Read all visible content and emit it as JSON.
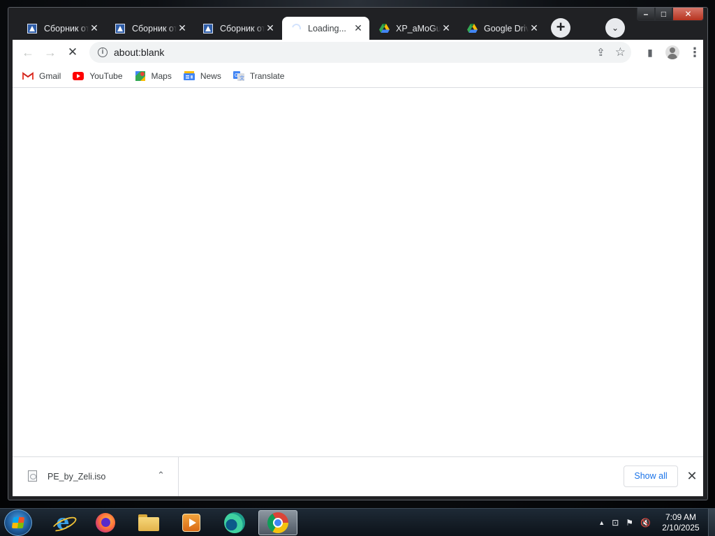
{
  "browser": {
    "tabs": [
      {
        "title": "Сборник от",
        "icon": "doc-icon",
        "active": false
      },
      {
        "title": "Сборник от",
        "icon": "doc-icon",
        "active": false
      },
      {
        "title": "Сборник от",
        "icon": "doc-icon",
        "active": false
      },
      {
        "title": "Loading...",
        "icon": "loading-spinner-icon",
        "active": true
      },
      {
        "title": "XP_aMoGus",
        "icon": "google-drive-icon",
        "active": false
      },
      {
        "title": "Google Drive",
        "icon": "google-drive-icon",
        "active": false
      }
    ],
    "new_tab_label": "+",
    "tab_search_label": "⌄",
    "window_controls": {
      "minimize": "–",
      "maximize": "□",
      "close": "✕"
    }
  },
  "toolbar": {
    "back_label": "←",
    "forward_label": "→",
    "stop_label": "✕",
    "url": "about:blank",
    "info_label": "i",
    "share_label": "⇪",
    "bookmark_label": "☆",
    "sidepanel_label": "▮",
    "menu_label": "⋮"
  },
  "bookmarks": [
    {
      "label": "Gmail",
      "icon": "gmail-icon"
    },
    {
      "label": "YouTube",
      "icon": "youtube-icon"
    },
    {
      "label": "Maps",
      "icon": "maps-icon"
    },
    {
      "label": "News",
      "icon": "news-icon"
    },
    {
      "label": "Translate",
      "icon": "translate-icon"
    }
  ],
  "downloads": {
    "file_name": "PE_by_Zeli.iso",
    "caret": "⌃",
    "show_all": "Show all",
    "close": "✕"
  },
  "taskbar": {
    "apps": [
      "internet-explorer-icon",
      "firefox-icon",
      "file-explorer-icon",
      "media-player-icon",
      "edge-icon",
      "chrome-icon"
    ],
    "tray": {
      "arrow": "▲",
      "network": "⊡",
      "flag": "⚑",
      "volume": "🔇"
    },
    "time": "7:09 AM",
    "date": "2/10/2025"
  },
  "colors": {
    "accent": "#1a73e8",
    "tabstrip": "#202124",
    "close_red": "#c0392b"
  }
}
